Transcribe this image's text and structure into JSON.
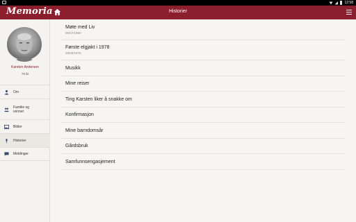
{
  "statusbar": {
    "time": "12:58"
  },
  "app": {
    "logo": "Memoria",
    "title": "Historier"
  },
  "profile": {
    "name": "Karsten Andersen",
    "age": "78 år"
  },
  "nav": [
    {
      "label": "Om",
      "icon": "person-icon"
    },
    {
      "label": "Familie og venner",
      "icon": "people-icon"
    },
    {
      "label": "Bilder",
      "icon": "image-icon"
    },
    {
      "label": "Historier",
      "icon": "microphone-icon",
      "active": true
    },
    {
      "label": "Meldinger",
      "icon": "message-icon"
    }
  ],
  "stories": [
    {
      "title": "Møte med Liv",
      "date": "06/07/1960"
    },
    {
      "title": "Første elgjakt i 1978",
      "date": "28/09/1978"
    },
    {
      "title": "Musikk",
      "date": ""
    },
    {
      "title": "Mine reiser",
      "date": ""
    },
    {
      "title": "Ting Karsten liker å snakke om",
      "date": ""
    },
    {
      "title": "Konfirmasjon",
      "date": ""
    },
    {
      "title": "Mine barndomsår",
      "date": ""
    },
    {
      "title": "Gårdsbruk",
      "date": ""
    },
    {
      "title": "Samfunnsengasjement",
      "date": ""
    }
  ],
  "colors": {
    "brand": "#8c1f2e",
    "background": "#f7f5f1"
  }
}
